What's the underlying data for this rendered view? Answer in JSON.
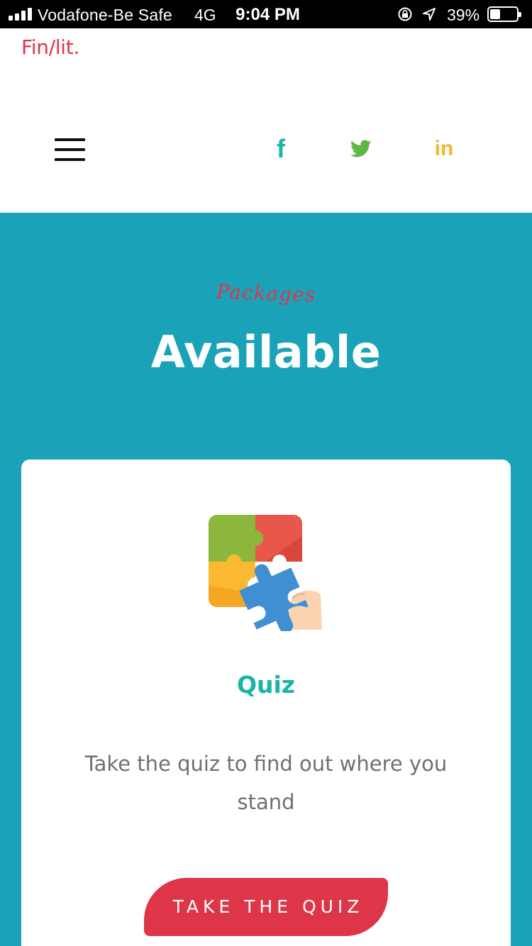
{
  "status_bar": {
    "carrier": "Vodafone-Be Safe",
    "network": "4G",
    "time": "9:04 PM",
    "battery_percent": "39%",
    "battery_level": 0.39
  },
  "header": {
    "logo": "Fin/lit.",
    "social": [
      "facebook-icon",
      "twitter-icon",
      "linkedin-icon"
    ],
    "social_glyphs": {
      "facebook": "f",
      "linkedin": "in"
    }
  },
  "hero": {
    "script_label": "Packages",
    "title": "Available"
  },
  "card": {
    "icon": "puzzle-icon",
    "title": "Quiz",
    "description": "Take the quiz to find out where you stand",
    "button_label": "TAKE THE QUIZ"
  },
  "colors": {
    "teal_background": "#1aa3b8",
    "accent_red": "#e0344b",
    "accent_teal": "#1ab5a7",
    "twitter_green": "#5db843",
    "linkedin_yellow": "#f5b52e"
  }
}
